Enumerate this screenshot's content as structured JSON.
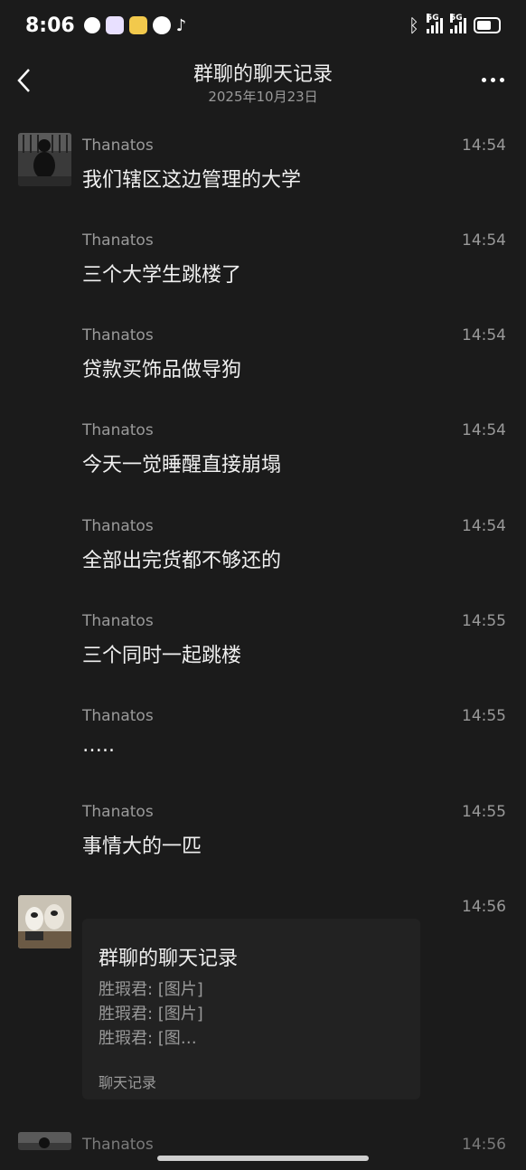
{
  "status_bar": {
    "time": "8:06",
    "network_1": "5G",
    "network_2": "5G",
    "battery_level": 0.7
  },
  "nav": {
    "title": "群聊的聊天记录",
    "subtitle": "2025年10月23日"
  },
  "messages": [
    {
      "sender": "Thanatos",
      "time": "14:54",
      "text": "我们辖区这边管理的大学"
    },
    {
      "sender": "Thanatos",
      "time": "14:54",
      "text": "三个大学生跳楼了"
    },
    {
      "sender": "Thanatos",
      "time": "14:54",
      "text": "贷款买饰品做导狗"
    },
    {
      "sender": "Thanatos",
      "time": "14:54",
      "text": "今天一觉睡醒直接崩塌"
    },
    {
      "sender": "Thanatos",
      "time": "14:54",
      "text": "全部出完货都不够还的"
    },
    {
      "sender": "Thanatos",
      "time": "14:55",
      "text": "三个同时一起跳楼"
    },
    {
      "sender": "Thanatos",
      "time": "14:55",
      "text": "…..",
      "_": ""
    },
    {
      "sender": "Thanatos",
      "time": "14:55",
      "text": "事情大的一匹"
    }
  ],
  "forwarded": {
    "time": "14:56",
    "title": "群聊的聊天记录",
    "lines": [
      "胜瑕君: [图片]",
      "胜瑕君: [图片]",
      "胜瑕君: [图…"
    ],
    "footer": "聊天记录"
  },
  "partial_message": {
    "sender": "Thanatos",
    "time": "14:56"
  }
}
